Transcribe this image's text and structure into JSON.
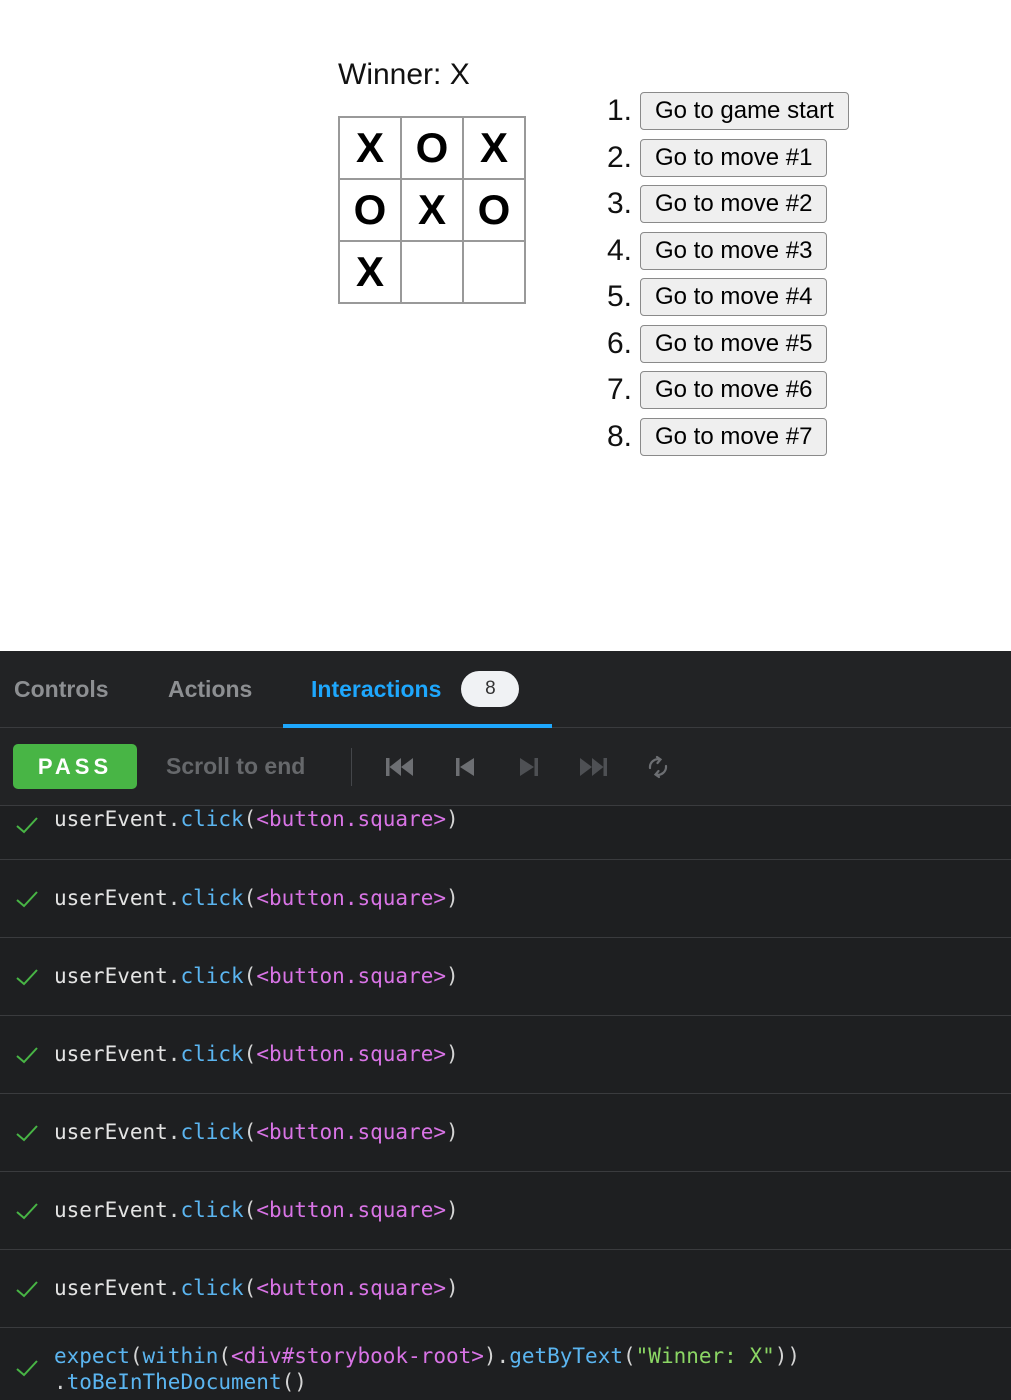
{
  "game": {
    "status": "Winner: X",
    "board": [
      "X",
      "O",
      "X",
      "O",
      "X",
      "O",
      "X",
      "",
      ""
    ],
    "moves": [
      {
        "num": "1.",
        "label": "Go to game start"
      },
      {
        "num": "2.",
        "label": "Go to move #1"
      },
      {
        "num": "3.",
        "label": "Go to move #2"
      },
      {
        "num": "4.",
        "label": "Go to move #3"
      },
      {
        "num": "5.",
        "label": "Go to move #4"
      },
      {
        "num": "6.",
        "label": "Go to move #5"
      },
      {
        "num": "7.",
        "label": "Go to move #6"
      },
      {
        "num": "8.",
        "label": "Go to move #7"
      }
    ]
  },
  "panel": {
    "tabs": {
      "controls": "Controls",
      "actions": "Actions",
      "interactions": "Interactions",
      "interactions_count": "8"
    },
    "toolbar": {
      "status": "PASS",
      "scroll_to_end": "Scroll to end",
      "icons": [
        "rewind-to-start-icon",
        "step-back-icon",
        "step-forward-icon",
        "skip-to-end-icon",
        "rerun-icon"
      ]
    },
    "click_step": {
      "obj": "userEvent",
      "dot": ".",
      "method": "click",
      "open": "(",
      "arg": "<button.square>",
      "close": ")"
    },
    "assert_step": {
      "fn_expect": "expect",
      "p1": "(",
      "fn_within": "within",
      "p2": "(",
      "el": "<div#storybook-root>",
      "p3": ").",
      "fn_get": "getByText",
      "p4": "(",
      "str": "\"Winner: X\"",
      "p5": "))",
      "dot": ".",
      "fn_matcher": "toBeInTheDocument",
      "p6": "()"
    },
    "colors": {
      "accent": "#1ea7fd",
      "pass": "#48b545",
      "check": "#48b545",
      "panel_bg": "#1e1f21"
    }
  }
}
